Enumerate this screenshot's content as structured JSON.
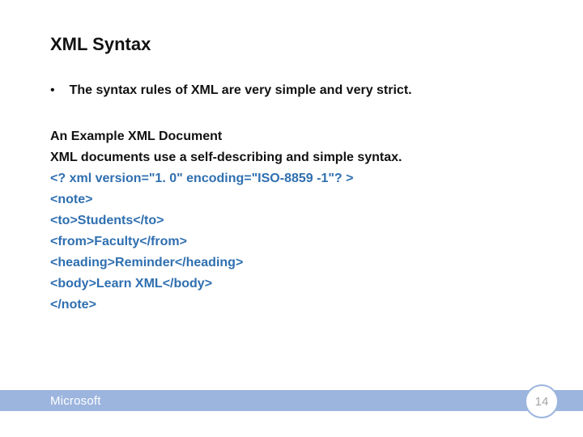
{
  "title": "XML Syntax",
  "bullet": {
    "dot": "•",
    "text": "The syntax rules of XML are very simple and very strict."
  },
  "body": {
    "line1": "An Example XML Document",
    "line2": "XML documents use a self-describing and simple syntax.",
    "line3": "<? xml version=\"1. 0\" encoding=\"ISO-8859 -1\"? >",
    "line4": "<note>",
    "line5": "<to>Students</to>",
    "line6": "<from>Faculty</from>",
    "line7": "<heading>Reminder</heading>",
    "line8": "<body>Learn XML</body>",
    "line9": "</note>"
  },
  "footer": {
    "brand": "Microsoft",
    "page": "14"
  }
}
